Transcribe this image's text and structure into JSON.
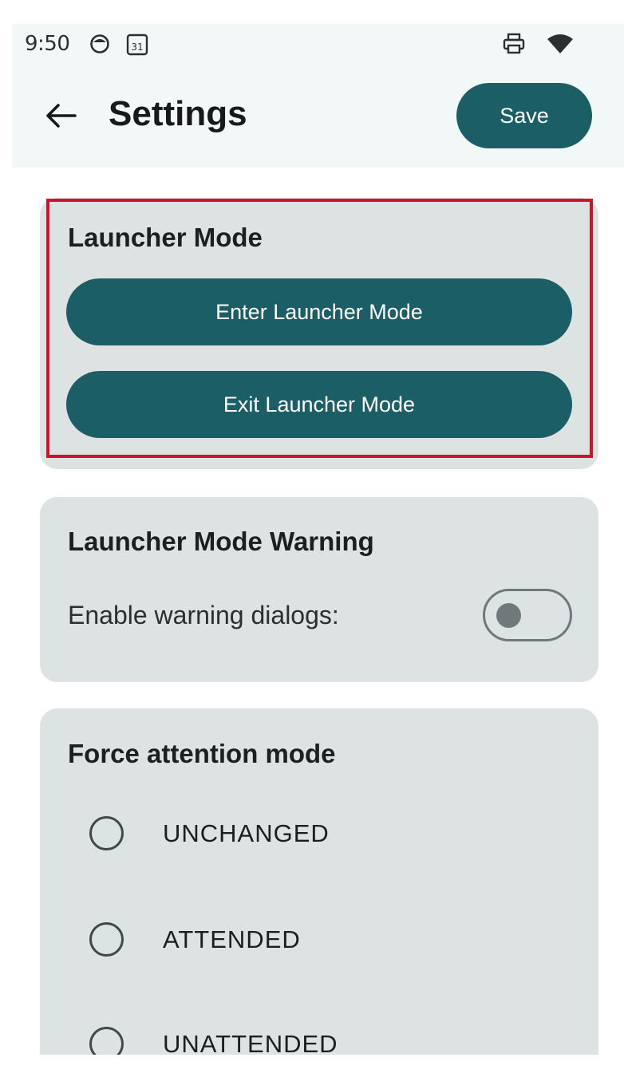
{
  "status_bar": {
    "time": "9:50",
    "left_icons": [
      "notification-face-icon",
      "calendar-icon"
    ],
    "calendar_day": "31",
    "right_icons": [
      "print-icon",
      "wifi-icon"
    ]
  },
  "app_bar": {
    "title": "Settings",
    "save_label": "Save",
    "back_icon": "arrow-back-icon"
  },
  "launcher_card": {
    "title": "Launcher Mode",
    "enter_label": "Enter Launcher Mode",
    "exit_label": "Exit Launcher Mode",
    "highlighted": true,
    "highlight_color": "#d4112b"
  },
  "warning_card": {
    "title": "Launcher Mode Warning",
    "toggle_label": "Enable warning dialogs:",
    "toggle_on": false
  },
  "attention_card": {
    "title": "Force attention mode",
    "options": [
      {
        "label": "UNCHANGED",
        "selected": false
      },
      {
        "label": "ATTENDED",
        "selected": false
      },
      {
        "label": "UNATTENDED",
        "selected": false
      }
    ]
  },
  "colors": {
    "primary": "#1b5e66",
    "card_bg": "#dde2e3",
    "app_bar_bg": "#f2f7f7"
  }
}
